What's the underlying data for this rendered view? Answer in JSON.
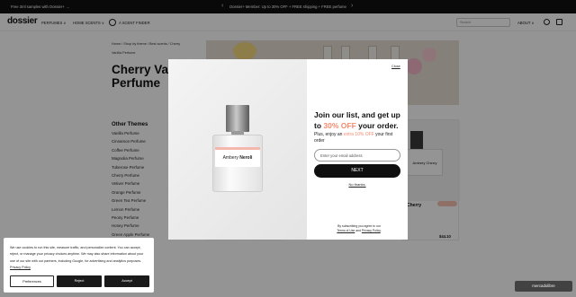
{
  "topbar": {
    "left": "Free 3ml samples with Dossier+ →",
    "center": "Dossier+ Member: Up to 30% OFF + FREE shipping + FREE perfume"
  },
  "nav": {
    "logo": "dossier",
    "perfumes": "PERFUMES ∨",
    "home_scents": "HOME SCENTS ∨",
    "finder": "A SCENT FINDER",
    "search_placeholder": "Search",
    "about": "ABOUT ∨"
  },
  "breadcrumb": {
    "line1": "Home  /  Shop by theme  /  Best scents  /  Cherry",
    "line2": "Vanilla Perfume"
  },
  "page_title": "Cherry Vanilla Perfume",
  "sidebar": {
    "title": "Other Themes",
    "items": [
      "Vanilla Perfume",
      "Cinnamon Perfume",
      "Coffee Perfume",
      "Magnolia Perfume",
      "Tuberose Perfume",
      "Cherry Perfume",
      "Vetiver Perfume",
      "Orange Perfume",
      "Green Tea Perfume",
      "Lemon Perfume",
      "Peony Perfume",
      "Honey Perfume",
      "Green Apple Perfume"
    ]
  },
  "product_card": {
    "label": "Ambery Cherry",
    "name": "Cherry",
    "price": "$44.10"
  },
  "modal": {
    "close": "Close",
    "bottle_label_a": "Ambery",
    "bottle_label_b": "Neroli",
    "headline_1": "Join our list, and get up to ",
    "headline_accent": "30% OFF",
    "headline_2": " your order.",
    "sub_1": "Plus, enjoy an ",
    "sub_accent": "extra 10% OFF",
    "sub_2": " your first order",
    "email_placeholder": "Enter your email address",
    "next": "NEXT",
    "no_thanks": "No thanks.",
    "terms_1": "By subscribing you agree to our",
    "terms_link1": "Terms of Use",
    "terms_and": " and ",
    "terms_link2": "Privacy Policy"
  },
  "cookie": {
    "text": "We use cookies to run this site, measure traffic, and personalize content. You can accept, reject, or manage your privacy choices anytime. We may also share information about your use of our site with our partners, including Google, for advertising and analytics purposes.",
    "link": "Privacy Policy",
    "preferences": "Preferences",
    "reject": "Reject",
    "accept": "Accept"
  },
  "watermark": "mercadolibre",
  "colors": {
    "accent": "#f58b6e",
    "dark": "#111111"
  }
}
